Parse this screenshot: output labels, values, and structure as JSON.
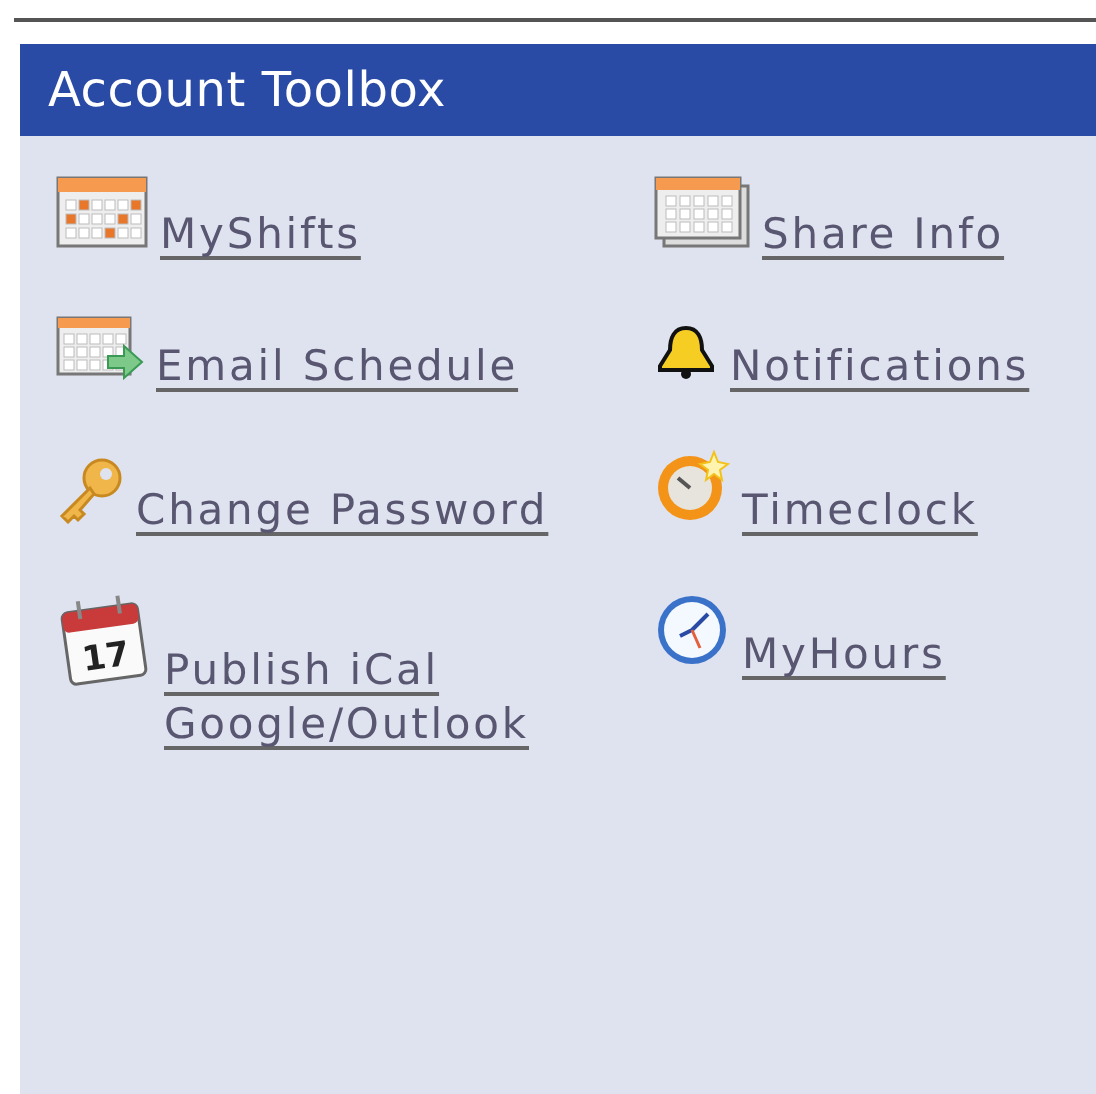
{
  "panel": {
    "title": "Account Toolbox",
    "items": [
      {
        "label": "MyShifts",
        "kind": "shifts"
      },
      {
        "label": "Share Info",
        "kind": "share"
      },
      {
        "label": "Email Schedule",
        "kind": "email"
      },
      {
        "label": "Notifications",
        "kind": "bell"
      },
      {
        "label": "Change Password",
        "kind": "key"
      },
      {
        "label": "Timeclock",
        "kind": "timeclock"
      },
      {
        "label": "Publish iCal Google/Outlook",
        "kind": "ical",
        "icon_text": "17"
      },
      {
        "label": "MyHours",
        "kind": "clock"
      }
    ]
  }
}
